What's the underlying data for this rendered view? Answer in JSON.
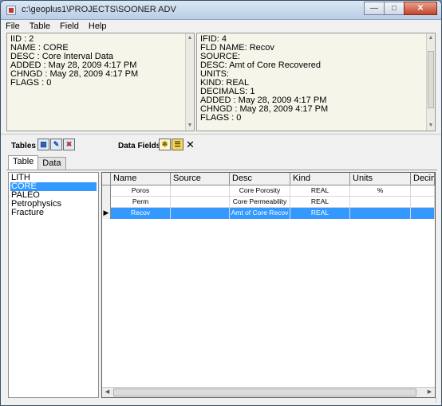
{
  "window": {
    "title": "c:\\geoplus1\\PROJECTS\\SOONER ADV"
  },
  "menu": [
    "File",
    "Table",
    "Field",
    "Help"
  ],
  "table_info": [
    "IID : 2",
    "NAME : CORE",
    "DESC : Core Interval Data",
    "ADDED : May 28, 2009 4:17 PM",
    "CHNGD : May 28, 2009 4:17 PM",
    "FLAGS : 0"
  ],
  "field_info": [
    "IFID: 4",
    "FLD NAME: Recov",
    "SOURCE:",
    "DESC: Amt of Core Recovered",
    "UNITS:",
    "KIND: REAL",
    "DECIMALS: 1",
    "ADDED : May 28, 2009 4:17 PM",
    "CHNGD : May 28, 2009 4:17 PM",
    "FLAGS : 0"
  ],
  "toolbar": {
    "tables_label": "Tables",
    "data_fields_label": "Data Fields"
  },
  "tabs": [
    "Table",
    "Data"
  ],
  "table_list": [
    "LITH",
    "CORE",
    "PALEO",
    "Petrophysics",
    "Fracture"
  ],
  "selected_table": "CORE",
  "grid": {
    "columns": [
      "Name",
      "Source",
      "Desc",
      "Kind",
      "Units",
      "Decim"
    ],
    "rows": [
      [
        "Poros",
        "",
        "Core Porosity",
        "REAL",
        "%",
        ""
      ],
      [
        "Perm",
        "",
        "Core Permeability",
        "REAL",
        "",
        ""
      ],
      [
        "Recov",
        "",
        "Amt of Core Recov",
        "REAL",
        "",
        ""
      ]
    ],
    "selected_row_marker": "▶"
  },
  "colors": {
    "selection": "#3399ff",
    "info_background": "#f6f5e9"
  }
}
